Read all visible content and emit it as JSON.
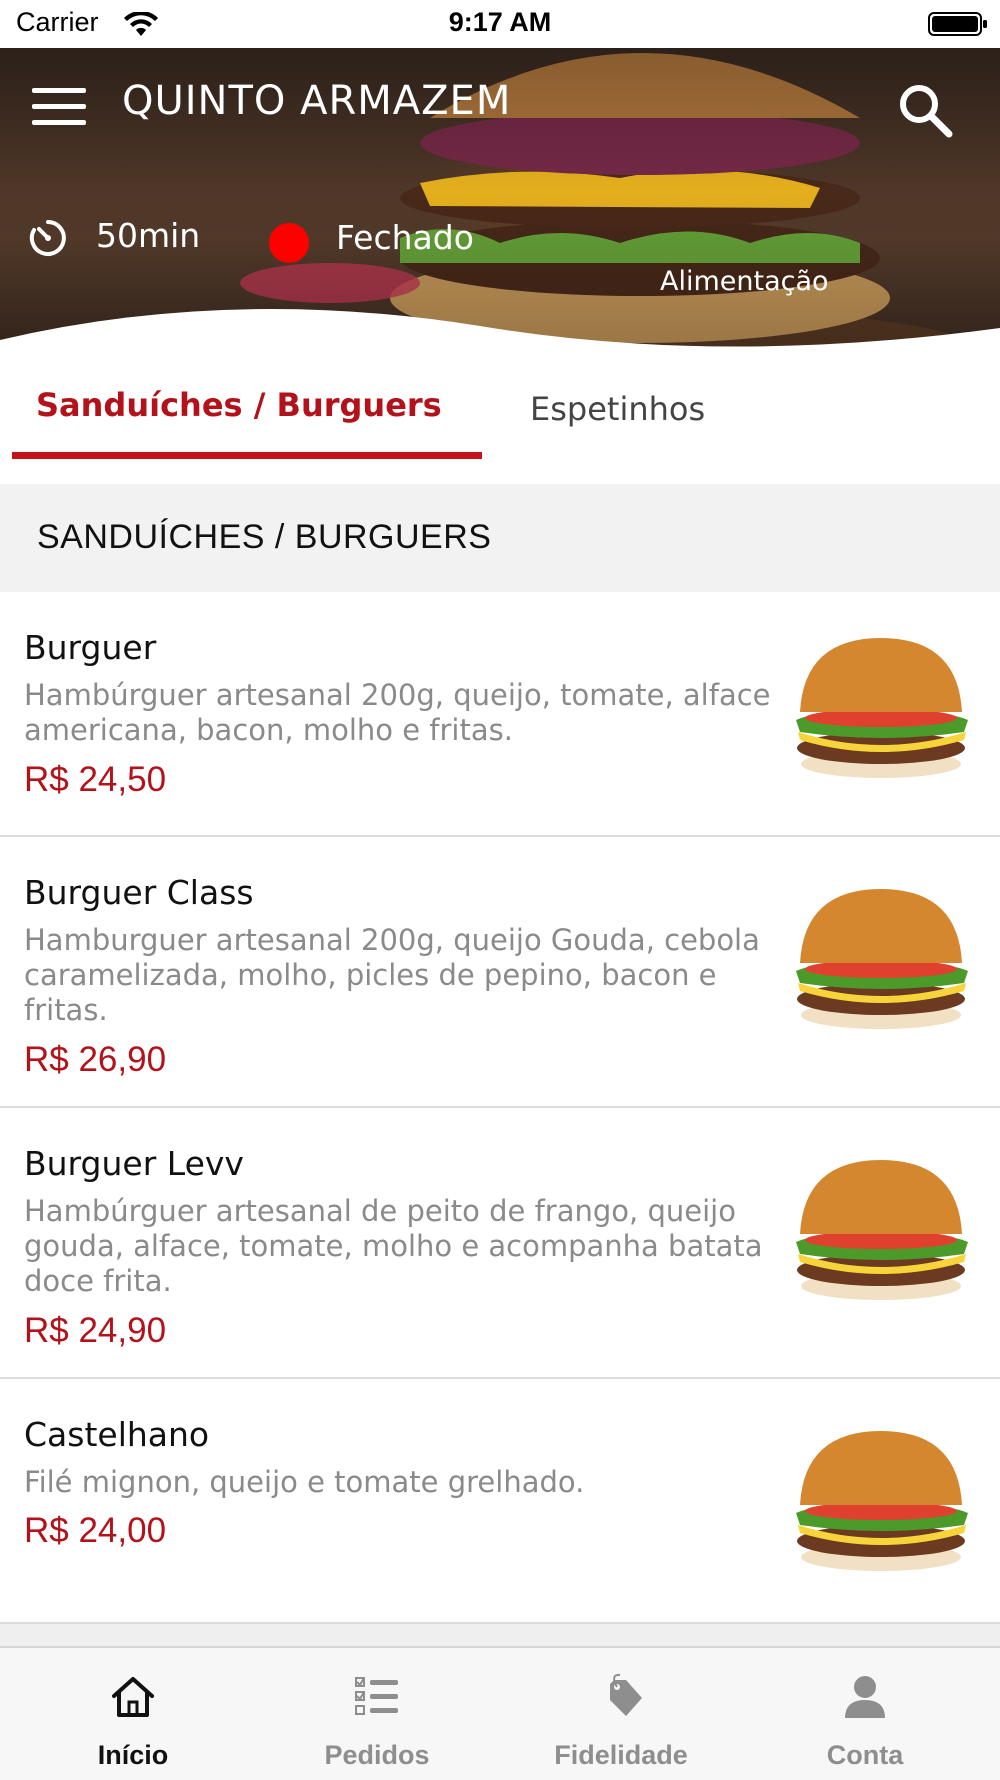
{
  "status_bar": {
    "carrier": "Carrier",
    "time": "9:17 AM"
  },
  "header": {
    "title": "QUINTO ARMAZEM",
    "delivery_time": "50min",
    "store_status": "Fechado",
    "store_status_color": "#ff0000",
    "category": "Alimentação",
    "icons": [
      "menu-icon",
      "search-icon",
      "timer-icon"
    ]
  },
  "tabs": [
    {
      "label": "Sanduíches / Burguers",
      "active": true
    },
    {
      "label": "Espetinhos",
      "active": false
    }
  ],
  "section": {
    "title": "SANDUÍCHES / BURGUERS"
  },
  "products": [
    {
      "name": "Burguer",
      "description": "Hambúrguer artesanal 200g, queijo, tomate, alface americana, bacon, molho e fritas.",
      "price": "R$ 24,50"
    },
    {
      "name": "Burguer Class",
      "description": "Hamburguer artesanal 200g, queijo Gouda, cebola caramelizada, molho, picles de pepino, bacon e fritas.",
      "price": "R$ 26,90"
    },
    {
      "name": "Burguer Levv",
      "description": "Hambúrguer artesanal de peito de frango, queijo gouda, alface, tomate, molho e acompanha batata doce frita.",
      "price": "R$ 24,90"
    },
    {
      "name": "Castelhano",
      "description": "Filé mignon, queijo e tomate grelhado.",
      "price": "R$ 24,00"
    }
  ],
  "bottom_nav": [
    {
      "label": "Início",
      "icon": "home-icon",
      "active": true
    },
    {
      "label": "Pedidos",
      "icon": "orders-list-icon",
      "active": false
    },
    {
      "label": "Fidelidade",
      "icon": "loyalty-tag-icon",
      "active": false
    },
    {
      "label": "Conta",
      "icon": "account-person-icon",
      "active": false
    }
  ],
  "colors": {
    "accent": "#b3121a",
    "status_closed": "#ff0000"
  }
}
